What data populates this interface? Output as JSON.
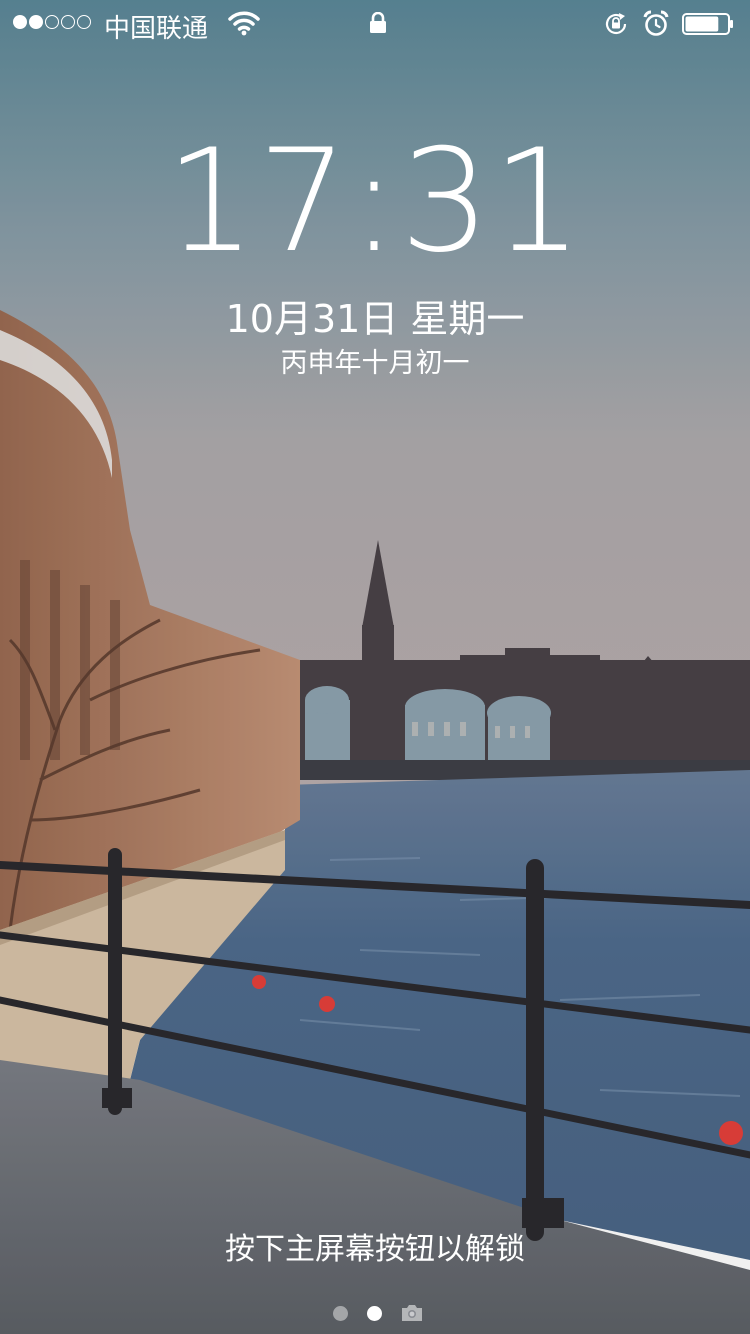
{
  "status_bar": {
    "signal_strength": 2,
    "signal_max": 5,
    "carrier": "中国联通",
    "wifi_icon": "wifi-icon",
    "lock_icon": "lock-icon",
    "rotation_lock_icon": "rotation-lock-icon",
    "alarm_icon": "alarm-icon",
    "battery_icon": "battery-icon",
    "battery_level": 0.8
  },
  "lock_screen": {
    "time": "17:31",
    "date": "10月31日 星期一",
    "lunar_date": "丙申年十月初一",
    "unlock_hint": "按下主屏幕按钮以解锁"
  },
  "pager": {
    "pages": 2,
    "current_page": 2,
    "camera_icon": "camera-icon"
  },
  "colors": {
    "text": "#ffffff",
    "sky_top": "#5d8a9a",
    "sky_bottom": "#b3aeb0",
    "water": "#4e6b8c"
  }
}
